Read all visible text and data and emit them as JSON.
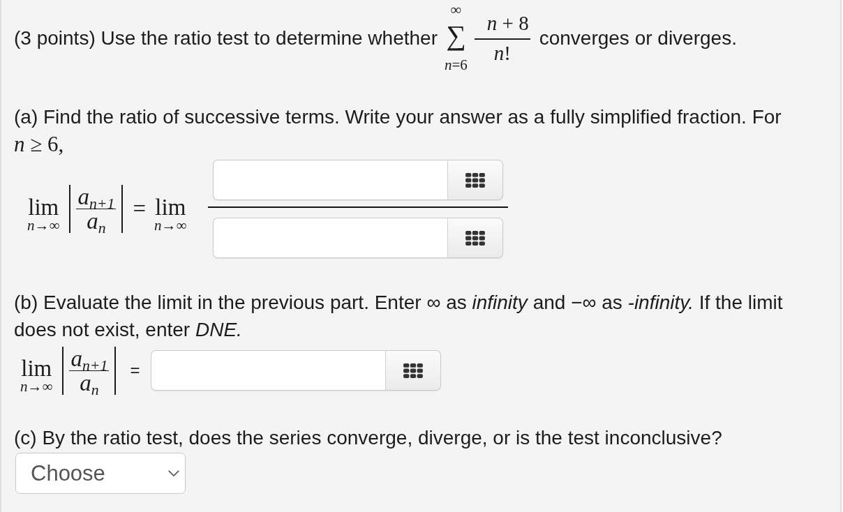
{
  "intro": {
    "lead": "(3 points) Use the ratio test to determine whether",
    "series": {
      "upper": "∞",
      "sigma": "∑",
      "lower": "*n*=6",
      "numerator": "*n* + 8",
      "denominator": "*n*!"
    },
    "tail": "converges or diverges."
  },
  "part_a": {
    "prompt": "(a) Find the ratio of successive terms. Write your answer as a fully simplified fraction. For",
    "condition": "*n* ≥ 6,",
    "limit": {
      "operator": "lim",
      "under": "*n*→∞",
      "numerator": "a$_{n+1}$",
      "denominator": "a$_{n}$",
      "equals": "=",
      "rhs_operator": "lim",
      "rhs_under": "*n*→∞"
    },
    "numerator_box": {
      "keypad": true
    },
    "denominator_box": {
      "keypad": true
    }
  },
  "part_b": {
    "prompt": "(b) Evaluate the limit in the previous part. Enter ∞ as *infinity* and −∞ as *-infinity.* If the limit does not exist, enter *DNE.*",
    "limit": {
      "operator": "lim",
      "under": "*n*→∞",
      "numerator": "a$_{n+1}$",
      "denominator": "a$_{n}$",
      "equals": "="
    },
    "answer_box": {
      "keypad": true
    }
  },
  "part_c": {
    "prompt": "(c) By the ratio test, does the series converge, diverge, or is the test inconclusive?",
    "dropdown": {
      "value": "Choose"
    }
  }
}
